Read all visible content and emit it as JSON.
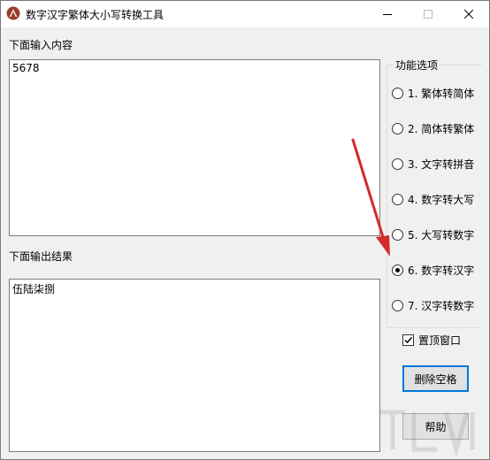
{
  "window": {
    "title": "数字汉字繁体大小写转换工具"
  },
  "input_section": {
    "label": "下面输入内容",
    "value": "5678"
  },
  "output_section": {
    "label": "下面输出结果",
    "value": "伍陆柒捌"
  },
  "options": {
    "group_label": "功能选项",
    "items": [
      {
        "label": "1. 繁体转简体",
        "checked": false
      },
      {
        "label": "2. 简体转繁体",
        "checked": false
      },
      {
        "label": "3. 文字转拼音",
        "checked": false
      },
      {
        "label": "4. 数字转大写",
        "checked": false
      },
      {
        "label": "5. 大写转数字",
        "checked": false
      },
      {
        "label": "6. 数字转汉字",
        "checked": true
      },
      {
        "label": "7. 汉字转数字",
        "checked": false
      }
    ]
  },
  "topmost": {
    "label": "置顶窗口",
    "checked": true
  },
  "buttons": {
    "delete_spaces": "删除空格",
    "help": "帮助"
  },
  "colors": {
    "annotation_arrow": "#d42a2a",
    "default_button_border": "#0078d7"
  }
}
